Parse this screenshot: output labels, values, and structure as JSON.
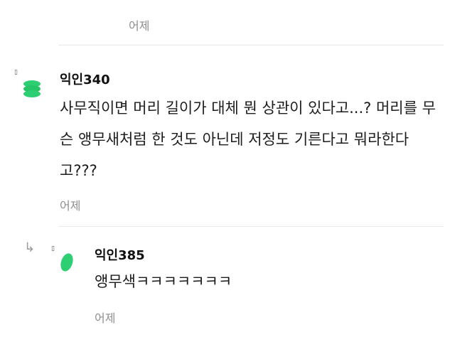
{
  "top_comment": {
    "timestamp": "어제"
  },
  "comment": {
    "author": "익인340",
    "text": "사무직이면 머리 길이가 대체 뭔 상관이 있다고...? 머리를 무슨 앵무새처럼 한 것도 아닌데 저정도 기른다고 뭐라한다고???",
    "timestamp": "어제",
    "avatar_color": "#2ecf72"
  },
  "reply": {
    "author": "익인385",
    "text": "앵무색ㅋㅋㅋㅋㅋㅋㅋ",
    "timestamp": "어제",
    "avatar_color": "#2ecf72"
  },
  "icons": {
    "small_marker": "▯",
    "reply_arrow": "↳"
  }
}
